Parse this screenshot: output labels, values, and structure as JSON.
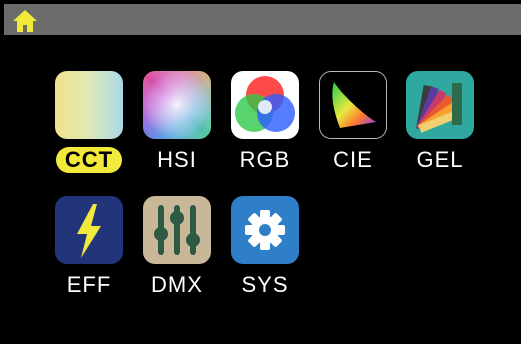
{
  "header": {
    "home_icon": "home-icon",
    "accent_color": "#f2ea3a"
  },
  "modes": [
    {
      "label": "CCT",
      "icon": "cct-gradient-icon",
      "selected": true
    },
    {
      "label": "HSI",
      "icon": "hsi-spectrum-icon",
      "selected": false
    },
    {
      "label": "RGB",
      "icon": "rgb-circles-icon",
      "selected": false
    },
    {
      "label": "CIE",
      "icon": "cie-chromaticity-icon",
      "selected": false
    },
    {
      "label": "GEL",
      "icon": "gel-swatch-fan-icon",
      "selected": false
    },
    {
      "label": "EFF",
      "icon": "lightning-bolt-icon",
      "selected": false
    },
    {
      "label": "DMX",
      "icon": "sliders-icon",
      "selected": false
    },
    {
      "label": "SYS",
      "icon": "gear-icon",
      "selected": false
    }
  ]
}
